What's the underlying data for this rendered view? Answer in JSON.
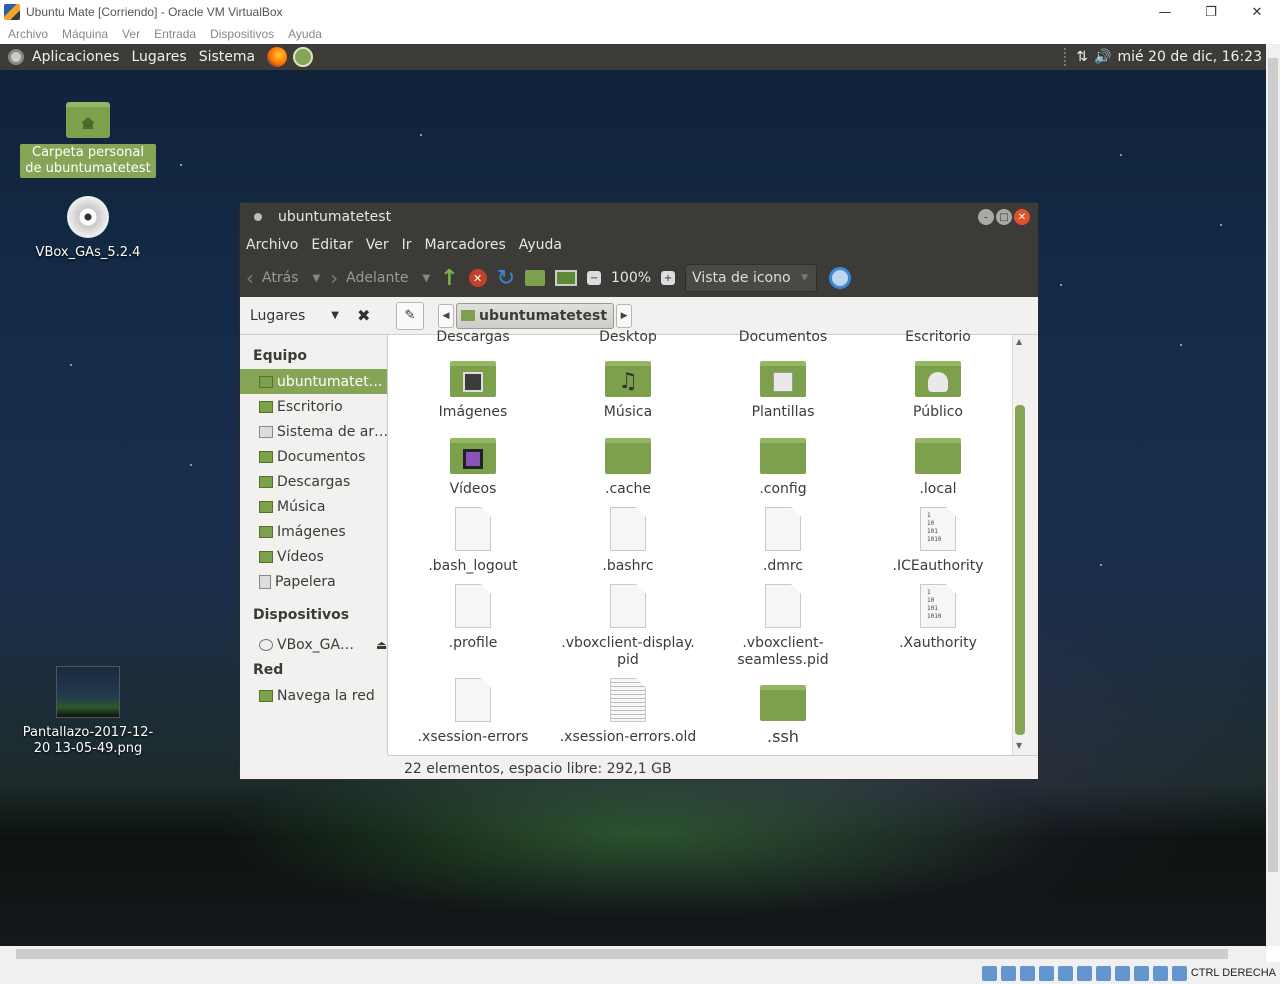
{
  "host": {
    "title": "Ubuntu Mate [Corriendo] - Oracle VM VirtualBox",
    "menu": [
      "Archivo",
      "Máquina",
      "Ver",
      "Entrada",
      "Dispositivos",
      "Ayuda"
    ],
    "hotkey": "CTRL DERECHA"
  },
  "panel": {
    "menus": [
      "Aplicaciones",
      "Lugares",
      "Sistema"
    ],
    "clock": "mié 20 de dic, 16:23"
  },
  "desktop": {
    "home_label": "Carpeta personal de ubuntumatetest",
    "cd_label": "VBox_GAs_5.2.4",
    "screenshot_label": "Pantallazo-2017-12-20 13-05-49.png"
  },
  "caja": {
    "title": "ubuntumatetest",
    "menu": [
      "Archivo",
      "Editar",
      "Ver",
      "Ir",
      "Marcadores",
      "Ayuda"
    ],
    "back_label": "Atrás",
    "forward_label": "Adelante",
    "zoom": "100%",
    "view_mode": "Vista de icono",
    "side_mode": "Lugares",
    "path": "ubuntumatetest",
    "sidebar": {
      "equipo_heading": "Equipo",
      "equipo": [
        "ubuntumatet…",
        "Escritorio",
        "Sistema de ar…",
        "Documentos",
        "Descargas",
        "Música",
        "Imágenes",
        "Vídeos",
        "Papelera"
      ],
      "dispositivos_heading": "Dispositivos",
      "dispositivos": [
        "VBox_GA…"
      ],
      "red_heading": "Red",
      "red": [
        "Navega la red"
      ]
    },
    "cut_row": [
      "Descargas",
      "Desktop",
      "Documentos",
      "Escritorio"
    ],
    "files": [
      "Imágenes",
      "Música",
      "Plantillas",
      "Público",
      "Vídeos",
      ".cache",
      ".config",
      ".local",
      ".bash_logout",
      ".bashrc",
      ".dmrc",
      ".ICEauthority",
      ".profile",
      ".vboxclient-display.\npid",
      ".vboxclient-\nseamless.pid",
      ".Xauthority",
      ".xsession-errors",
      ".xsession-errors.old",
      ".ssh"
    ],
    "status": "22 elementos, espacio libre: 292,1 GB"
  }
}
